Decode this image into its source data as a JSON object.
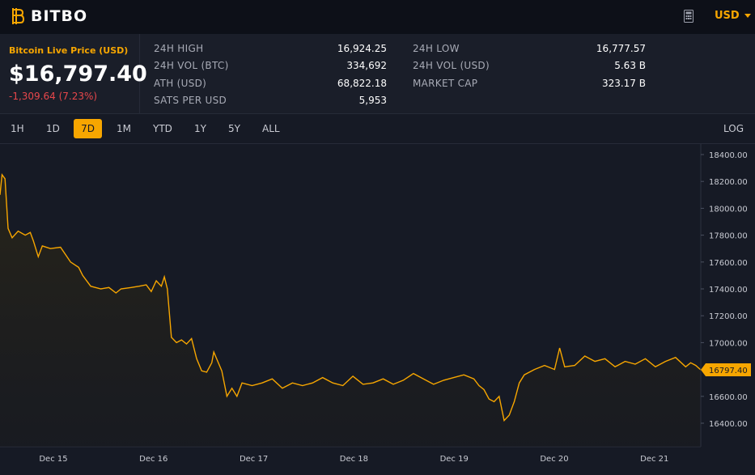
{
  "app": {
    "name": "BITBO"
  },
  "header": {
    "currency": "USD",
    "calculator_icon": "calculator-icon",
    "logo_icon": "bitbo-b-icon"
  },
  "price": {
    "label": "Bitcoin Live Price (USD)",
    "value": "$16,797.40",
    "change": "-1,309.64 (7.23%)"
  },
  "stats": [
    {
      "label": "24H HIGH",
      "value": "16,924.25"
    },
    {
      "label": "24H VOL (BTC)",
      "value": "334,692"
    },
    {
      "label": "ATH (USD)",
      "value": "68,822.18"
    },
    {
      "label": "SATS PER USD",
      "value": "5,953"
    },
    {
      "label": "24H LOW",
      "value": "16,777.57"
    },
    {
      "label": "24H VOL (USD)",
      "value": "5.63 B"
    },
    {
      "label": "MARKET CAP",
      "value": "323.17 B"
    }
  ],
  "ranges": [
    "1H",
    "1D",
    "7D",
    "1M",
    "YTD",
    "1Y",
    "5Y",
    "ALL"
  ],
  "active_range": "7D",
  "log_label": "LOG",
  "colors": {
    "accent": "#f7a600",
    "negative": "#e8474b",
    "background": "#161a25"
  },
  "chart_data": {
    "type": "line",
    "x_tick_labels": [
      "Dec 15",
      "Dec 16",
      "Dec 17",
      "Dec 18",
      "Dec 19",
      "Dec 20",
      "Dec 21"
    ],
    "y_tick_labels": [
      "18400.00",
      "18200.00",
      "18000.00",
      "17800.00",
      "17600.00",
      "17400.00",
      "17200.00",
      "17000.00",
      "16800.00",
      "16600.00",
      "16400.00"
    ],
    "ylim": [
      16300,
      18450
    ],
    "current_value_label": "16797.40",
    "current_value": 16797.4,
    "x_range_days": [
      0,
      6.95
    ],
    "series": [
      {
        "points": [
          [
            0.0,
            18100
          ],
          [
            0.02,
            18250
          ],
          [
            0.05,
            18220
          ],
          [
            0.08,
            17850
          ],
          [
            0.12,
            17780
          ],
          [
            0.18,
            17830
          ],
          [
            0.25,
            17800
          ],
          [
            0.3,
            17820
          ],
          [
            0.33,
            17760
          ],
          [
            0.38,
            17640
          ],
          [
            0.42,
            17720
          ],
          [
            0.5,
            17700
          ],
          [
            0.6,
            17710
          ],
          [
            0.7,
            17600
          ],
          [
            0.78,
            17560
          ],
          [
            0.82,
            17500
          ],
          [
            0.9,
            17420
          ],
          [
            1.0,
            17400
          ],
          [
            1.08,
            17410
          ],
          [
            1.15,
            17370
          ],
          [
            1.2,
            17400
          ],
          [
            1.3,
            17410
          ],
          [
            1.38,
            17420
          ],
          [
            1.45,
            17430
          ],
          [
            1.5,
            17380
          ],
          [
            1.55,
            17460
          ],
          [
            1.6,
            17420
          ],
          [
            1.63,
            17490
          ],
          [
            1.66,
            17400
          ],
          [
            1.7,
            17040
          ],
          [
            1.75,
            17000
          ],
          [
            1.8,
            17020
          ],
          [
            1.85,
            16990
          ],
          [
            1.9,
            17030
          ],
          [
            1.95,
            16880
          ],
          [
            2.0,
            16790
          ],
          [
            2.05,
            16780
          ],
          [
            2.1,
            16850
          ],
          [
            2.12,
            16930
          ],
          [
            2.16,
            16860
          ],
          [
            2.2,
            16790
          ],
          [
            2.25,
            16600
          ],
          [
            2.3,
            16660
          ],
          [
            2.35,
            16600
          ],
          [
            2.4,
            16700
          ],
          [
            2.5,
            16680
          ],
          [
            2.6,
            16700
          ],
          [
            2.7,
            16730
          ],
          [
            2.8,
            16660
          ],
          [
            2.9,
            16700
          ],
          [
            3.0,
            16680
          ],
          [
            3.1,
            16700
          ],
          [
            3.2,
            16740
          ],
          [
            3.3,
            16700
          ],
          [
            3.4,
            16680
          ],
          [
            3.5,
            16750
          ],
          [
            3.6,
            16690
          ],
          [
            3.7,
            16700
          ],
          [
            3.8,
            16730
          ],
          [
            3.9,
            16690
          ],
          [
            4.0,
            16720
          ],
          [
            4.1,
            16770
          ],
          [
            4.2,
            16730
          ],
          [
            4.3,
            16690
          ],
          [
            4.4,
            16720
          ],
          [
            4.5,
            16740
          ],
          [
            4.6,
            16760
          ],
          [
            4.7,
            16730
          ],
          [
            4.75,
            16680
          ],
          [
            4.8,
            16650
          ],
          [
            4.85,
            16580
          ],
          [
            4.9,
            16560
          ],
          [
            4.95,
            16600
          ],
          [
            5.0,
            16420
          ],
          [
            5.05,
            16460
          ],
          [
            5.1,
            16560
          ],
          [
            5.15,
            16700
          ],
          [
            5.2,
            16760
          ],
          [
            5.3,
            16800
          ],
          [
            5.4,
            16830
          ],
          [
            5.5,
            16800
          ],
          [
            5.55,
            16960
          ],
          [
            5.6,
            16820
          ],
          [
            5.7,
            16830
          ],
          [
            5.8,
            16900
          ],
          [
            5.9,
            16860
          ],
          [
            6.0,
            16880
          ],
          [
            6.1,
            16820
          ],
          [
            6.2,
            16860
          ],
          [
            6.3,
            16840
          ],
          [
            6.4,
            16880
          ],
          [
            6.5,
            16820
          ],
          [
            6.6,
            16860
          ],
          [
            6.7,
            16890
          ],
          [
            6.8,
            16820
          ],
          [
            6.85,
            16850
          ],
          [
            6.9,
            16830
          ],
          [
            6.95,
            16797
          ]
        ]
      }
    ]
  }
}
